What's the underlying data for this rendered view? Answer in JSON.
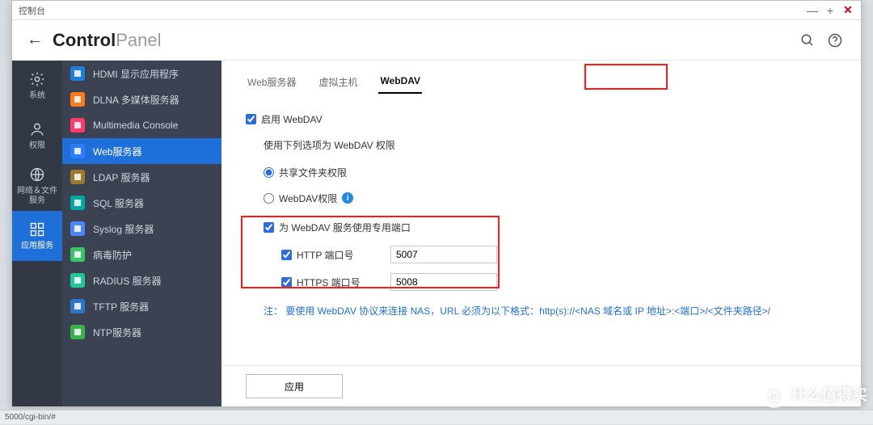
{
  "window": {
    "title": "控制台",
    "brand_strong": "Control",
    "brand_light": "Panel"
  },
  "status_bar": "5000/cgi-bin/#",
  "watermark": "什么值得买",
  "nav_primary": [
    {
      "id": "system",
      "label": "系统"
    },
    {
      "id": "perm",
      "label": "权限"
    },
    {
      "id": "network",
      "label": "网络＆文件\n服务"
    },
    {
      "id": "apps",
      "label": "应用服务",
      "active": true
    }
  ],
  "nav_secondary": [
    {
      "id": "hdmi",
      "label": "HDMI 显示应用程序",
      "color": "#1e7fd6"
    },
    {
      "id": "dlna",
      "label": "DLNA 多媒体服务器",
      "color": "#ff7a1a"
    },
    {
      "id": "mmc",
      "label": "Multimedia Console",
      "color": "#ff3b6b"
    },
    {
      "id": "web",
      "label": "Web服务器",
      "color": "#2e7bff",
      "active": true
    },
    {
      "id": "ldap",
      "label": "LDAP 服务器",
      "color": "#9a7b2c"
    },
    {
      "id": "sql",
      "label": "SQL 服务器",
      "color": "#00a9a0"
    },
    {
      "id": "syslog",
      "label": "Syslog 服务器",
      "color": "#4b86ff"
    },
    {
      "id": "av",
      "label": "病毒防护",
      "color": "#39c46b"
    },
    {
      "id": "radius",
      "label": "RADIUS 服务器",
      "color": "#23c59a"
    },
    {
      "id": "tftp",
      "label": "TFTP 服务器",
      "color": "#2c77c9"
    },
    {
      "id": "ntp",
      "label": "NTP服务器",
      "color": "#37b34a"
    }
  ],
  "tabs": [
    {
      "id": "webserver",
      "label": "Web服务器"
    },
    {
      "id": "vhost",
      "label": "虚拟主机"
    },
    {
      "id": "webdav",
      "label": "WebDAV",
      "active": true
    }
  ],
  "form": {
    "enable_label": "启用 WebDAV",
    "enable_checked": true,
    "perm_hint": "使用下列选项为 WebDAV 权限",
    "radio_share": "共享文件夹权限",
    "radio_webdav": "WebDAV权限",
    "radio_value": "share",
    "port_section_label": "为 WebDAV 服务使用专用端口",
    "port_section_checked": true,
    "http_label": "HTTP 端口号",
    "http_checked": true,
    "http_value": "5007",
    "https_label": "HTTPS 端口号",
    "https_checked": true,
    "https_value": "5008",
    "note": "注： 要使用 WebDAV 协议来连接 NAS，URL 必须为以下格式：http(s)://<NAS 域名或 IP 地址>:<端口>/<文件夹路径>/"
  },
  "buttons": {
    "apply": "应用"
  }
}
